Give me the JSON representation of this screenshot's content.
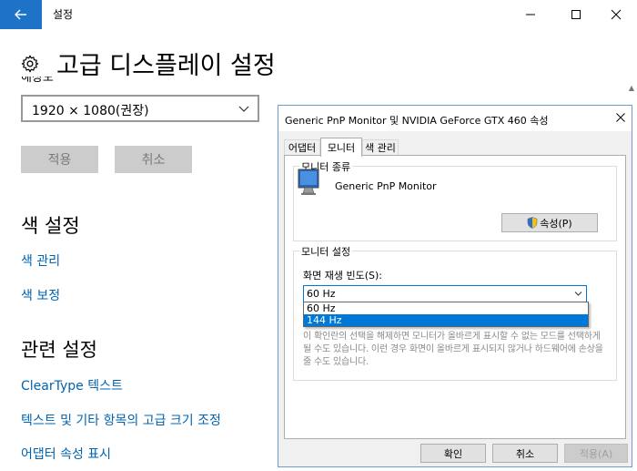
{
  "window": {
    "title": "설정"
  },
  "page": {
    "title": "고급 디스플레이 설정",
    "resolution_label": "해상도",
    "resolution_value": "1920 × 1080(권장)",
    "apply_label": "적용",
    "cancel_label": "취소"
  },
  "color_section": {
    "title": "색 설정",
    "links": [
      "색 관리",
      "색 보정"
    ]
  },
  "related_section": {
    "title": "관련 설정",
    "links": [
      "ClearType 텍스트",
      "텍스트 및 기타 항목의 고급 크기 조정",
      "어댑터 속성 표시"
    ]
  },
  "dialog": {
    "title": "Generic PnP Monitor 및 NVIDIA GeForce GTX 460 속성",
    "tabs": [
      "어댑터",
      "모니터",
      "색 관리"
    ],
    "active_tab": "모니터",
    "monitor_type_group": "모니터 종류",
    "monitor_name": "Generic PnP Monitor",
    "properties_button": "속성(P)",
    "monitor_settings_group": "모니터 설정",
    "refresh_label": "화면 재생 빈도(S):",
    "refresh_value": "60 Hz",
    "refresh_options": [
      "60 Hz",
      "144 Hz"
    ],
    "refresh_highlighted": "144 Hz",
    "warning_text": "이 확인란의 선택을 해제하면 모니터가 올바르게 표시할 수 없는 모드를 선택하게 될 수도 있습니다. 이런 경우 화면이 올바르게 표시되지 않거나 하드웨어에 손상을 줄 수도 있습니다.",
    "ok_label": "확인",
    "cancel_label": "취소",
    "apply_label": "적용(A)"
  },
  "colors": {
    "accent": "#1e73c8",
    "link": "#0063b1",
    "selection": "#0078d7"
  }
}
